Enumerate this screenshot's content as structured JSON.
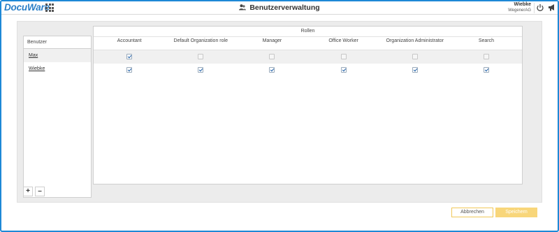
{
  "header": {
    "logo": "DocuWare",
    "title": "Benutzerverwaltung",
    "user_name": "Wiebke",
    "user_org": "WegenerAG"
  },
  "users": {
    "header": "Benutzer",
    "items": [
      {
        "name": "Max"
      },
      {
        "name": "Wiebke"
      }
    ]
  },
  "roles": {
    "group_label": "Rollen",
    "columns": [
      "Accountant",
      "Default Organization role",
      "Manager",
      "Office Worker",
      "Organization Administrator",
      "Search"
    ],
    "assignments": [
      [
        true,
        false,
        false,
        false,
        false,
        false
      ],
      [
        true,
        true,
        true,
        true,
        true,
        true
      ]
    ]
  },
  "controls": {
    "add": "+",
    "remove": "–"
  },
  "footer": {
    "cancel": "Abbrechen",
    "save": "Speichern"
  },
  "colors": {
    "frame": "#1e88d6",
    "logo": "#2b7fc7",
    "save_button": "#f8d67a",
    "check": "#1f5fa8"
  }
}
